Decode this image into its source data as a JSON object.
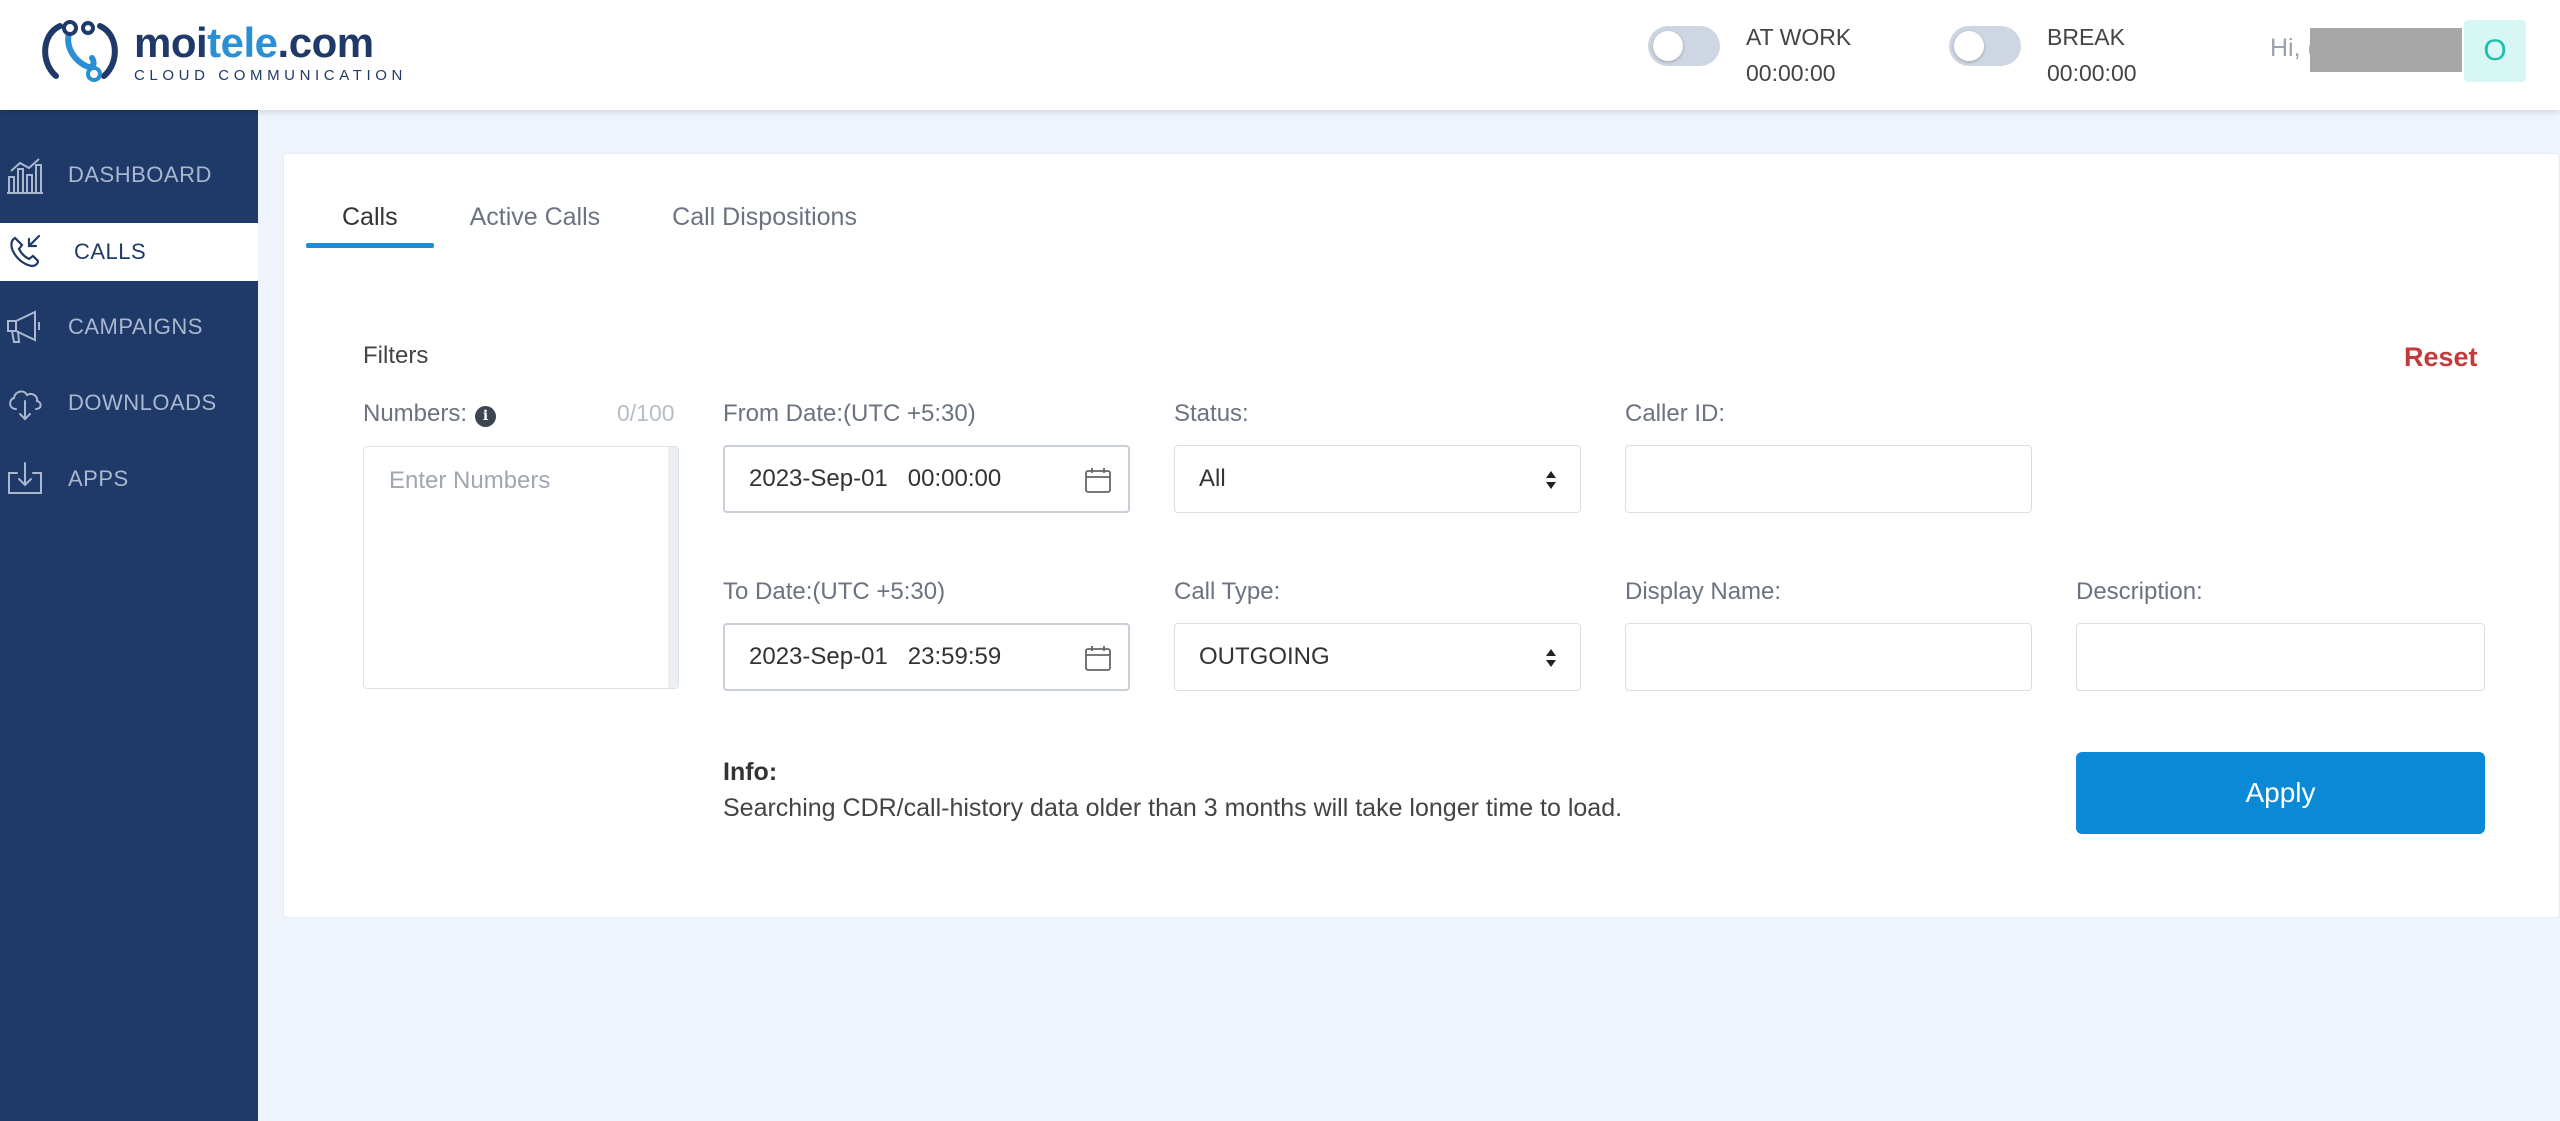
{
  "brand": {
    "name_main": "moi",
    "name_accent": "tele",
    "name_tail": ".com",
    "tagline": "CLOUD COMMUNICATION",
    "primary_color": "#1f3a68",
    "accent_color": "#2b8fd6"
  },
  "header": {
    "at_work": {
      "label": "AT WORK",
      "time": "00:00:00",
      "on": false
    },
    "break": {
      "label": "BREAK",
      "time": "00:00:00",
      "on": false
    },
    "greeting": "Hi, (",
    "avatar_initial": "O"
  },
  "sidebar": {
    "items": [
      {
        "label": "DASHBOARD",
        "icon": "chart-icon",
        "active": false
      },
      {
        "label": "CALLS",
        "icon": "phone-incoming-icon",
        "active": true
      },
      {
        "label": "CAMPAIGNS",
        "icon": "megaphone-icon",
        "active": false
      },
      {
        "label": "DOWNLOADS",
        "icon": "cloud-download-icon",
        "active": false
      },
      {
        "label": "APPS",
        "icon": "tray-download-icon",
        "active": false
      }
    ]
  },
  "tabs": [
    {
      "label": "Calls",
      "active": true
    },
    {
      "label": "Active Calls",
      "active": false
    },
    {
      "label": "Call Dispositions",
      "active": false
    }
  ],
  "filters": {
    "title": "Filters",
    "reset_label": "Reset",
    "numbers": {
      "label": "Numbers:",
      "count": "0/100",
      "placeholder": "Enter Numbers"
    },
    "from_date": {
      "label": "From Date:(UTC +5:30)",
      "value": "2023-Sep-01   00:00:00"
    },
    "to_date": {
      "label": "To Date:(UTC +5:30)",
      "value": "2023-Sep-01   23:59:59"
    },
    "status": {
      "label": "Status:",
      "value": "All"
    },
    "call_type": {
      "label": "Call Type:",
      "value": "OUTGOING"
    },
    "caller_id": {
      "label": "Caller ID:",
      "value": ""
    },
    "display_name": {
      "label": "Display Name:",
      "value": ""
    },
    "description": {
      "label": "Description:",
      "value": ""
    }
  },
  "info": {
    "title": "Info:",
    "text": "Searching CDR/call-history data older than 3 months will take longer time to load."
  },
  "apply_label": "Apply",
  "colors": {
    "apply_button": "#0a8ad6",
    "reset_text": "#c23b3b",
    "tab_underline": "#1a8cd8"
  }
}
